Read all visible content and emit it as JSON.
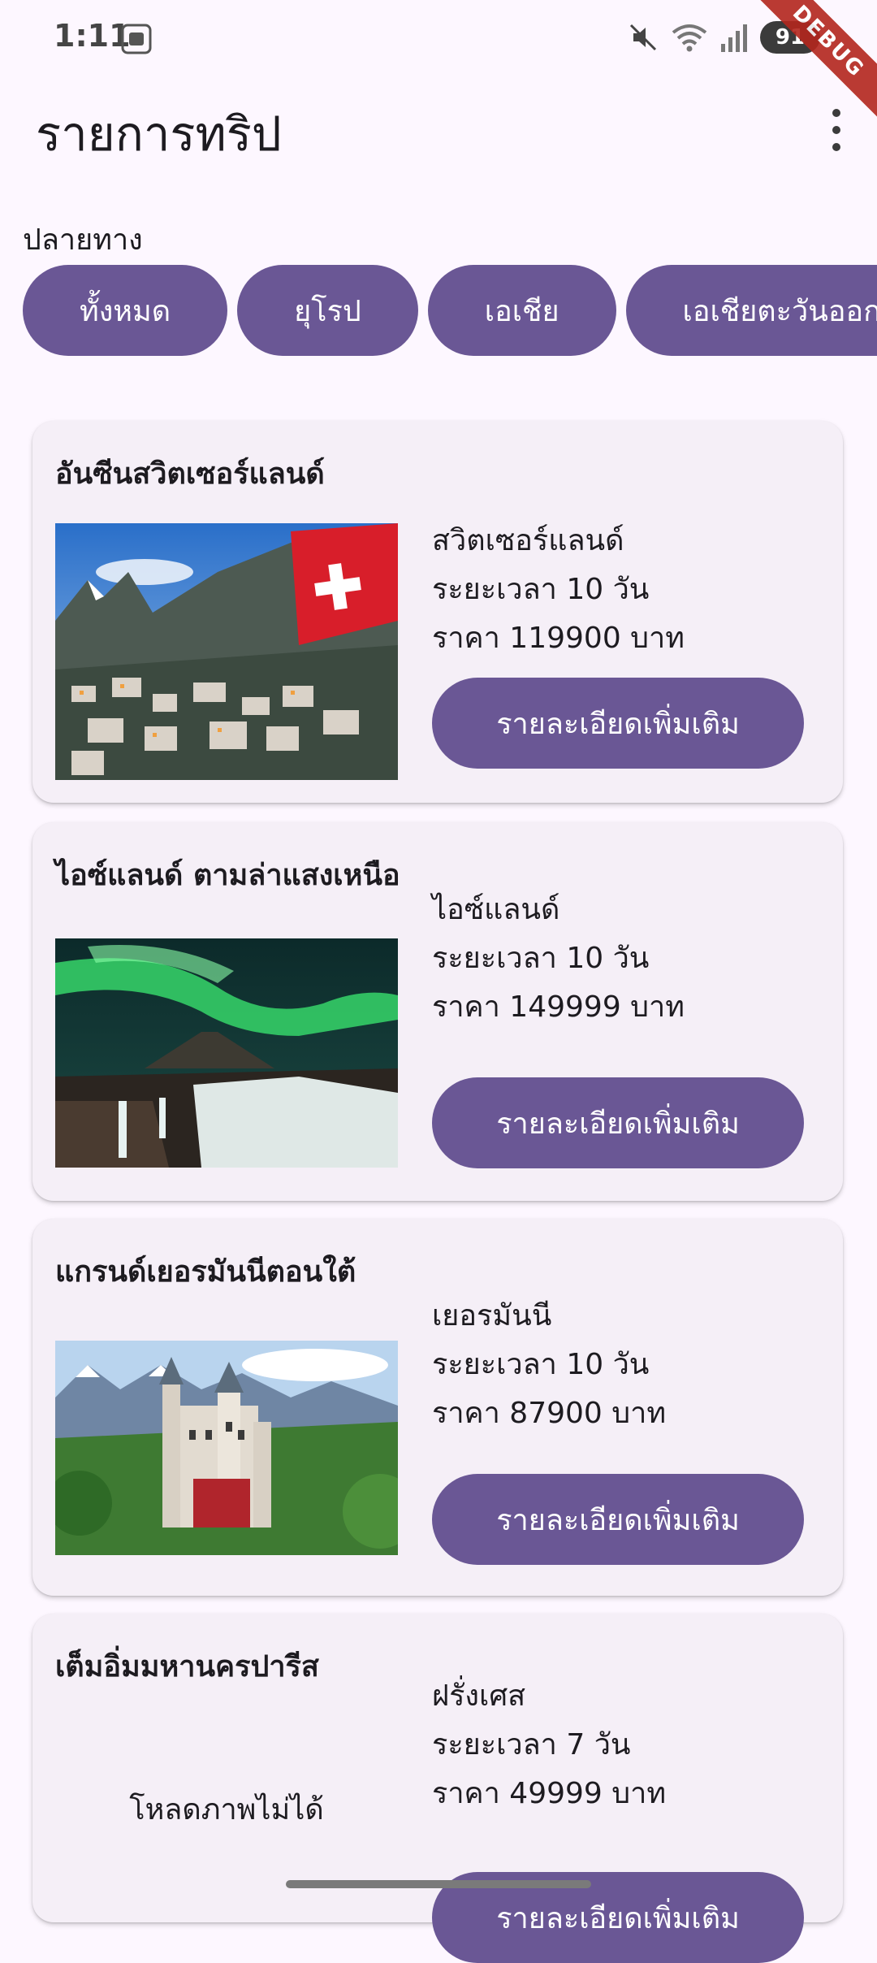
{
  "status": {
    "time": "1:11",
    "battery": "91",
    "banner": "DEBUG"
  },
  "app": {
    "title": "รายการทริป"
  },
  "filter": {
    "label": "ปลายทาง",
    "chips": [
      "ทั้งหมด",
      "ยุโรป",
      "เอเชีย",
      "เอเชียตะวันออก"
    ]
  },
  "trips": [
    {
      "title": "อันซีนสวิตเซอร์แลนด์",
      "country": "สวิตเซอร์แลนด์",
      "duration": "ระยะเวลา 10 วัน",
      "price": "ราคา 119900 บาท",
      "button": "รายละเอียดเพิ่มเติม"
    },
    {
      "title": "ไอซ์แลนด์ ตามล่าแสงเหนือ",
      "country": "ไอซ์แลนด์",
      "duration": "ระยะเวลา 10 วัน",
      "price": "ราคา 149999 บาท",
      "button": "รายละเอียดเพิ่มเติม"
    },
    {
      "title": "แกรนด์เยอรมันนีตอนใต้",
      "country": "เยอรมันนี",
      "duration": "ระยะเวลา 10 วัน",
      "price": "ราคา 87900 บาท",
      "button": "รายละเอียดเพิ่มเติม"
    },
    {
      "title": "เต็มอิ่มมหานครปารีส",
      "country": "ฝรั่งเศส",
      "duration": "ระยะเวลา 7 วัน",
      "price": "ราคา 49999 บาท",
      "button": "รายละเอียดเพิ่มเติม",
      "image_error": "โหลดภาพไม่ได้"
    }
  ],
  "colors": {
    "accent": "#6a5795",
    "background": "#fdf7ff",
    "card": "#f5eff7"
  }
}
